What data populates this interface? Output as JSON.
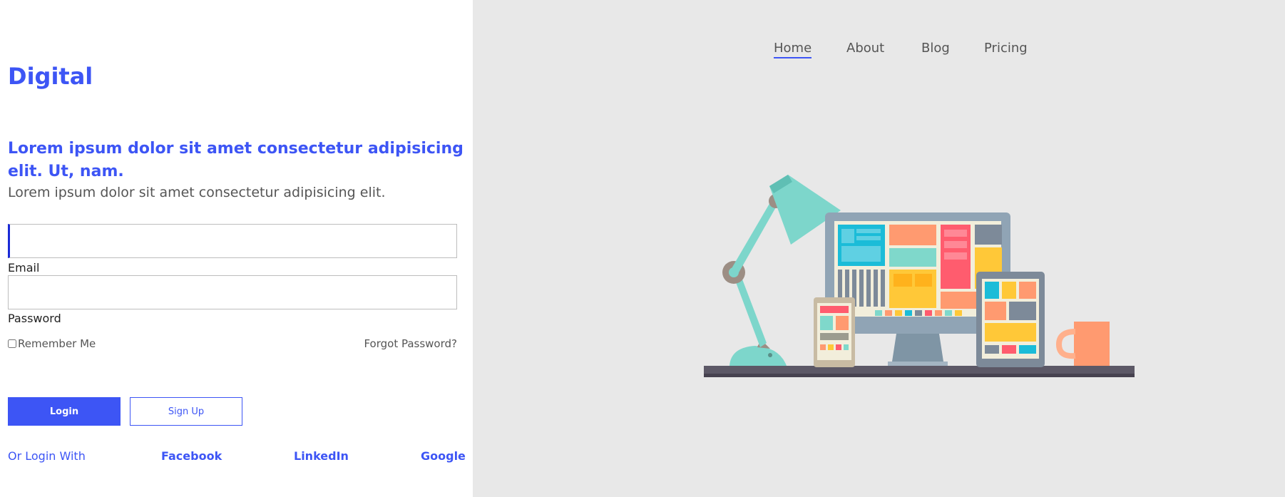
{
  "brand": "Digital",
  "hero": {
    "headline": "Lorem ipsum dolor sit amet consectetur adipisicing elit. Ut, nam.",
    "subtext": "Lorem ipsum dolor sit amet consectetur adipisicing elit."
  },
  "form": {
    "email_label": "Email",
    "email_value": "",
    "password_label": "Password",
    "password_value": "",
    "remember_label": "Remember Me",
    "remember_checked": false,
    "forgot_label": "Forgot Password?",
    "login_label": "Login",
    "signup_label": "Sign Up"
  },
  "social": {
    "prefix": "Or Login With",
    "providers": [
      "Facebook",
      "LinkedIn",
      "Google"
    ]
  },
  "nav": {
    "items": [
      "Home",
      "About",
      "Blog",
      "Pricing"
    ],
    "active": "Home"
  },
  "colors": {
    "accent": "#3d55f5",
    "right_panel_bg": "#e8e8e8"
  },
  "illustration": {
    "icons": [
      "desk-lamp-icon",
      "desktop-monitor-icon",
      "phone-icon",
      "tablet-icon",
      "mug-icon"
    ]
  }
}
